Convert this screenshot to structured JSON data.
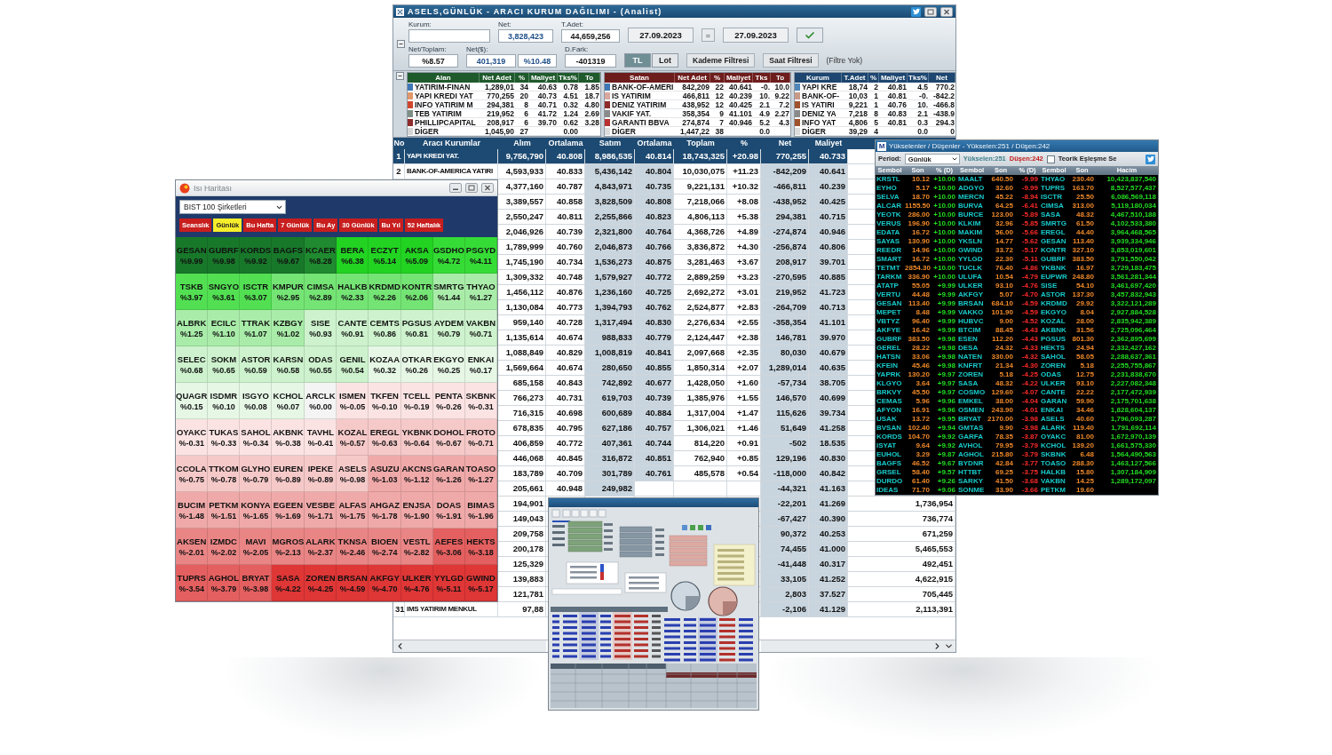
{
  "main_window": {
    "title": "ASELS,GÜNLÜK - ARACI KURUM DAĞILIMI - (Analist)",
    "form": {
      "kurum": {
        "label": "Kurum:"
      },
      "net": {
        "label": "Net:",
        "value": "3,828,423"
      },
      "total_quantity": {
        "label": "T.Adet:",
        "value": "44,659,256"
      },
      "date_from": "27.09.2023",
      "date_separator": "=",
      "date_to": "27.09.2023",
      "net_ratio": {
        "label": "Net/Toplam:",
        "value": "%8.57"
      },
      "net_usd": {
        "label": "Net($):",
        "value": "401,319",
        "percent": "%10.48"
      },
      "difference": {
        "label": "D.Fark:",
        "value": "-401319"
      },
      "unit_toggle": [
        {
          "label": "TL",
          "selected": true
        },
        {
          "label": "Lot",
          "selected": false
        }
      ],
      "filter_buttons": [
        "Kademe Filtresi",
        "Saat Filtresi"
      ],
      "filter_status": "(Filtre Yok)"
    },
    "summary_tables": [
      {
        "kind": "buyers",
        "title": "Alan",
        "columns": [
          "Net Adet",
          "%",
          "Maliyet",
          "Tks%",
          "To"
        ],
        "rows": [
          {
            "color": "#3f78b5",
            "name": "YATIRIM-FINAN",
            "cells": [
              "1,289,01",
              "34",
              "40.63",
              "0.78",
              "1.85"
            ]
          },
          {
            "color": "#e0986a",
            "name": "YAPI KREDI YAT",
            "cells": [
              "770,255",
              "20",
              "40.73",
              "4.51",
              "18.7"
            ]
          },
          {
            "color": "#d0452e",
            "name": "INFO YATIRIM M",
            "cells": [
              "294,381",
              "8",
              "40.71",
              "0.32",
              "4.80"
            ]
          },
          {
            "color": "#7e8f86",
            "name": "TEB YATIRIM",
            "cells": [
              "219,952",
              "6",
              "41.72",
              "1.24",
              "2.69"
            ]
          },
          {
            "color": "#8e2a2a",
            "name": "PHILLIPCAPITAL",
            "cells": [
              "208,917",
              "6",
              "39.70",
              "0.62",
              "3.28"
            ]
          },
          {
            "color": "#d4d4d4",
            "name": "DİGER",
            "cells": [
              "1,045,90",
              "27",
              null,
              "0.00",
              null
            ]
          }
        ]
      },
      {
        "kind": "sellers",
        "title": "Satan",
        "columns": [
          "Net Adet",
          "%",
          "Maliyet",
          "Tks",
          "To"
        ],
        "rows": [
          {
            "color": "#3f78b5",
            "name": "BANK-OF-AMERI",
            "cells": [
              "842,209",
              "22",
              "40.641",
              "-0.",
              "10.0"
            ]
          },
          {
            "color": "#d8a8a0",
            "name": "IS YATIRIM",
            "cells": [
              "466,811",
              "12",
              "40.239",
              "10.",
              "9.22"
            ]
          },
          {
            "color": "#8e2a2a",
            "name": "DENIZ YATIRIM",
            "cells": [
              "438,952",
              "12",
              "40.425",
              "2.1",
              "7.2"
            ]
          },
          {
            "color": "#8a8a8a",
            "name": "VAKIF YAT.",
            "cells": [
              "358,354",
              "9",
              "41.101",
              "4.9",
              "2.27"
            ]
          },
          {
            "color": "#b83030",
            "name": "GARANTI BBVA",
            "cells": [
              "274,874",
              "7",
              "40.946",
              "5.2",
              "4.3"
            ]
          },
          {
            "color": "#dcdcdc",
            "name": "DİGER",
            "cells": [
              "1,447,22",
              "38",
              null,
              "0.0",
              null
            ]
          }
        ]
      },
      {
        "kind": "brokers",
        "title": "Kurum",
        "columns": [
          "T.Adet",
          "%",
          "Maliyet",
          "Tks%",
          "Net"
        ],
        "rows": [
          {
            "color": "#4f86b8",
            "name": "YAPI KRE",
            "cells": [
              "18,74",
              "2",
              "40.81",
              "4.5",
              "770.2"
            ]
          },
          {
            "color": "#c89a88",
            "name": "BANK-OF-",
            "cells": [
              "10,03",
              "1",
              "40.81",
              "-0.",
              "-842.2"
            ]
          },
          {
            "color": "#a0522d",
            "name": "IS YATIRI",
            "cells": [
              "9,221",
              "1",
              "40.76",
              "10.",
              "-466.8"
            ]
          },
          {
            "color": "#8a8a8a",
            "name": "DENIZ YA",
            "cells": [
              "7,218",
              "8",
              "40.83",
              "2.1",
              "-438.9"
            ]
          },
          {
            "color": "#a0522d",
            "name": "INFO YAT",
            "cells": [
              "4,806",
              "5",
              "40.81",
              "0.3",
              "294.3"
            ]
          },
          {
            "color": "#dcdcdc",
            "name": "DİGER",
            "cells": [
              "39,29",
              "4",
              null,
              "0.0",
              "0"
            ]
          }
        ]
      }
    ],
    "broker_table": {
      "columns": [
        "No",
        "Aracı Kurumlar",
        "Alım",
        "Ortalama",
        "Satım",
        "Ortalama",
        "Toplam",
        "%",
        "Net",
        "Maliyet"
      ],
      "rows": [
        {
          "selected": true,
          "cells": [
            "1",
            "YAPI KREDI YAT.",
            "9,756,790",
            "40.808",
            "8,986,535",
            "40.814",
            "18,743,325",
            "+20.98",
            "770,255",
            "40.733",
            null
          ]
        },
        {
          "selected": false,
          "cells": [
            "2",
            "BANK-OF-AMERICA YATIRI",
            "4,593,933",
            "40.833",
            "5,436,142",
            "40.804",
            "10,030,075",
            "+11.23",
            "-842,209",
            "40.641",
            null
          ]
        },
        {
          "selected": false,
          "cells": [
            null,
            null,
            "4,377,160",
            "40.787",
            "4,843,971",
            "40.735",
            "9,221,131",
            "+10.32",
            "-466,811",
            "40.239",
            null
          ]
        },
        {
          "selected": false,
          "cells": [
            null,
            null,
            "3,389,557",
            "40.858",
            "3,828,509",
            "40.808",
            "7,218,066",
            "+8.08",
            "-438,952",
            "40.425",
            null
          ]
        },
        {
          "selected": false,
          "cells": [
            null,
            null,
            "2,550,247",
            "40.811",
            "2,255,866",
            "40.823",
            "4,806,113",
            "+5.38",
            "294,381",
            "40.715",
            null
          ]
        },
        {
          "selected": false,
          "cells": [
            null,
            null,
            "2,046,926",
            "40.739",
            "2,321,800",
            "40.764",
            "4,368,726",
            "+4.89",
            "-274,874",
            "40.946",
            null
          ]
        },
        {
          "selected": false,
          "cells": [
            null,
            null,
            "1,789,999",
            "40.760",
            "2,046,873",
            "40.766",
            "3,836,872",
            "+4.30",
            "-256,874",
            "40.806",
            null
          ]
        },
        {
          "selected": false,
          "cells": [
            null,
            null,
            "1,745,190",
            "40.734",
            "1,536,273",
            "40.875",
            "3,281,463",
            "+3.67",
            "208,917",
            "39.701",
            null
          ]
        },
        {
          "selected": false,
          "cells": [
            null,
            null,
            "1,309,332",
            "40.748",
            "1,579,927",
            "40.772",
            "2,889,259",
            "+3.23",
            "-270,595",
            "40.885",
            null
          ]
        },
        {
          "selected": false,
          "cells": [
            null,
            null,
            "1,456,112",
            "40.876",
            "1,236,160",
            "40.725",
            "2,692,272",
            "+3.01",
            "219,952",
            "41.723",
            null
          ]
        },
        {
          "selected": false,
          "cells": [
            null,
            null,
            "1,130,084",
            "40.773",
            "1,394,793",
            "40.762",
            "2,524,877",
            "+2.83",
            "-264,709",
            "40.713",
            null
          ]
        },
        {
          "selected": false,
          "cells": [
            null,
            null,
            "959,140",
            "40.728",
            "1,317,494",
            "40.830",
            "2,276,634",
            "+2.55",
            "-358,354",
            "41.101",
            null
          ]
        },
        {
          "selected": false,
          "cells": [
            null,
            null,
            "1,135,614",
            "40.674",
            "988,833",
            "40.779",
            "2,124,447",
            "+2.38",
            "146,781",
            "39.970",
            null
          ]
        },
        {
          "selected": false,
          "cells": [
            null,
            null,
            "1,088,849",
            "40.829",
            "1,008,819",
            "40.841",
            "2,097,668",
            "+2.35",
            "80,030",
            "40.679",
            null
          ]
        },
        {
          "selected": false,
          "cells": [
            null,
            null,
            "1,569,664",
            "40.674",
            "280,650",
            "40.855",
            "1,850,314",
            "+2.07",
            "1,289,014",
            "40.635",
            null
          ]
        },
        {
          "selected": false,
          "cells": [
            null,
            null,
            "685,158",
            "40.843",
            "742,892",
            "40.677",
            "1,428,050",
            "+1.60",
            "-57,734",
            "38.705",
            null
          ]
        },
        {
          "selected": false,
          "cells": [
            null,
            null,
            "766,273",
            "40.731",
            "619,703",
            "40.739",
            "1,385,976",
            "+1.55",
            "146,570",
            "40.699",
            null
          ]
        },
        {
          "selected": false,
          "cells": [
            null,
            null,
            "716,315",
            "40.698",
            "600,689",
            "40.884",
            "1,317,004",
            "+1.47",
            "115,626",
            "39.734",
            null
          ]
        },
        {
          "selected": false,
          "cells": [
            null,
            null,
            "678,835",
            "40.795",
            "627,186",
            "40.757",
            "1,306,021",
            "+1.46",
            "51,649",
            "41.258",
            null
          ]
        },
        {
          "selected": false,
          "cells": [
            null,
            null,
            "406,859",
            "40.772",
            "407,361",
            "40.744",
            "814,220",
            "+0.91",
            "-502",
            "18.535",
            null
          ]
        },
        {
          "selected": false,
          "cells": [
            null,
            null,
            "446,068",
            "40.845",
            "316,872",
            "40.851",
            "762,940",
            "+0.85",
            "129,196",
            "40.830",
            null
          ]
        },
        {
          "selected": false,
          "cells": [
            null,
            null,
            "183,789",
            "40.709",
            "301,789",
            "40.761",
            "485,578",
            "+0.54",
            "-118,000",
            "40.842",
            null
          ]
        },
        {
          "selected": false,
          "cells": [
            null,
            null,
            "205,661",
            "40.948",
            "249,982",
            null,
            null,
            null,
            "-44,321",
            "41.163",
            null
          ]
        },
        {
          "selected": false,
          "cells": [
            null,
            null,
            "194,901",
            null,
            null,
            null,
            null,
            null,
            "-22,201",
            "41.269",
            "1,736,954"
          ]
        },
        {
          "selected": false,
          "cells": [
            null,
            null,
            "149,043",
            null,
            null,
            null,
            null,
            null,
            "-67,427",
            "40.390",
            "736,774"
          ]
        },
        {
          "selected": false,
          "cells": [
            null,
            null,
            "209,758",
            null,
            null,
            null,
            null,
            null,
            "90,372",
            "40.253",
            "671,259"
          ]
        },
        {
          "selected": false,
          "cells": [
            null,
            null,
            "200,178",
            null,
            null,
            null,
            null,
            null,
            "74,455",
            "41.000",
            "5,465,553"
          ]
        },
        {
          "selected": false,
          "cells": [
            null,
            null,
            "125,329",
            null,
            null,
            null,
            null,
            null,
            "-41,448",
            "40.317",
            "492,451"
          ]
        },
        {
          "selected": false,
          "cells": [
            null,
            null,
            "139,883",
            null,
            null,
            null,
            null,
            null,
            "33,105",
            "41.252",
            "4,622,915"
          ]
        },
        {
          "selected": false,
          "cells": [
            null,
            null,
            "121,781",
            null,
            null,
            null,
            null,
            null,
            "2,803",
            "37.527",
            "705,445"
          ]
        },
        {
          "selected": false,
          "cells": [
            "31",
            "IMS YATIRIM MENKUL",
            "97,88",
            null,
            null,
            null,
            null,
            null,
            "-2,106",
            "41.129",
            "2,113,391"
          ]
        }
      ]
    }
  },
  "heatmap_window": {
    "title": "Isı Haritası",
    "index_selector": "BIST 100 Şirketleri",
    "tabs": [
      {
        "label": "Seanslık",
        "selected": false
      },
      {
        "label": "Günlük",
        "selected": true
      },
      {
        "label": "Bu Hafta",
        "selected": false
      },
      {
        "label": "7 Günlük",
        "selected": false
      },
      {
        "label": "Bu Ay",
        "selected": false
      },
      {
        "label": "30 Günlük",
        "selected": false
      },
      {
        "label": "Bu Yıl",
        "selected": false
      },
      {
        "label": "52 Haftalık",
        "selected": false
      }
    ],
    "cells": [
      {
        "symbol": "GESAN",
        "change": "%9.99",
        "color": "#18782a"
      },
      {
        "symbol": "GUBRF",
        "change": "%9.98",
        "color": "#18782a"
      },
      {
        "symbol": "KORDS",
        "change": "%9.92",
        "color": "#18782a"
      },
      {
        "symbol": "BAGFS",
        "change": "%9.67",
        "color": "#18782a"
      },
      {
        "symbol": "KCAER",
        "change": "%8.28",
        "color": "#1f8a2f"
      },
      {
        "symbol": "BERA",
        "change": "%6.38",
        "color": "#22d322"
      },
      {
        "symbol": "ECZYT",
        "change": "%5.14",
        "color": "#22d322"
      },
      {
        "symbol": "AKSA",
        "change": "%5.09",
        "color": "#22d322"
      },
      {
        "symbol": "GSDHO",
        "change": "%4.72",
        "color": "#36dc36"
      },
      {
        "symbol": "PSGYD",
        "change": "%4.11",
        "color": "#36dc36"
      },
      {
        "symbol": "TSKB",
        "change": "%3.97",
        "color": "#52e052"
      },
      {
        "symbol": "SNGYO",
        "change": "%3.61",
        "color": "#52e052"
      },
      {
        "symbol": "ISCTR",
        "change": "%3.07",
        "color": "#52e052"
      },
      {
        "symbol": "KMPUR",
        "change": "%2.95",
        "color": "#74e474"
      },
      {
        "symbol": "CIMSA",
        "change": "%2.89",
        "color": "#74e474"
      },
      {
        "symbol": "HALKB",
        "change": "%2.33",
        "color": "#74e474"
      },
      {
        "symbol": "KRDMD",
        "change": "%2.26",
        "color": "#74e474"
      },
      {
        "symbol": "KONTR",
        "change": "%2.06",
        "color": "#74e474"
      },
      {
        "symbol": "SMRTG",
        "change": "%1.44",
        "color": "#a9eca9"
      },
      {
        "symbol": "THYAO",
        "change": "%1.27",
        "color": "#a9eca9"
      },
      {
        "symbol": "ALBRK",
        "change": "%1.25",
        "color": "#a9eca9"
      },
      {
        "symbol": "ECILC",
        "change": "%1.10",
        "color": "#a9eca9"
      },
      {
        "symbol": "TTRAK",
        "change": "%1.07",
        "color": "#a9eca9"
      },
      {
        "symbol": "KZBGY",
        "change": "%1.02",
        "color": "#a9eca9"
      },
      {
        "symbol": "SISE",
        "change": "%0.93",
        "color": "#cdf2cd"
      },
      {
        "symbol": "CANTE",
        "change": "%0.91",
        "color": "#cdf2cd"
      },
      {
        "symbol": "CEMTS",
        "change": "%0.86",
        "color": "#cdf2cd"
      },
      {
        "symbol": "PGSUS",
        "change": "%0.81",
        "color": "#cdf2cd"
      },
      {
        "symbol": "AYDEM",
        "change": "%0.79",
        "color": "#cdf2cd"
      },
      {
        "symbol": "VAKBN",
        "change": "%0.71",
        "color": "#cdf2cd"
      },
      {
        "symbol": "SELEC",
        "change": "%0.68",
        "color": "#cdf2cd"
      },
      {
        "symbol": "SOKM",
        "change": "%0.65",
        "color": "#cdf2cd"
      },
      {
        "symbol": "ASTOR",
        "change": "%0.59",
        "color": "#cdf2cd"
      },
      {
        "symbol": "KARSN",
        "change": "%0.58",
        "color": "#cdf2cd"
      },
      {
        "symbol": "ODAS",
        "change": "%0.55",
        "color": "#cdf2cd"
      },
      {
        "symbol": "GENIL",
        "change": "%0.54",
        "color": "#cdf2cd"
      },
      {
        "symbol": "KOZAA",
        "change": "%0.32",
        "color": "#e6f7e6"
      },
      {
        "symbol": "OTKAR",
        "change": "%0.26",
        "color": "#e6f7e6"
      },
      {
        "symbol": "EKGYO",
        "change": "%0.25",
        "color": "#e6f7e6"
      },
      {
        "symbol": "ENKAI",
        "change": "%0.17",
        "color": "#e6f7e6"
      },
      {
        "symbol": "QUAGR",
        "change": "%0.15",
        "color": "#e6f7e6"
      },
      {
        "symbol": "ISDMR",
        "change": "%0.10",
        "color": "#e6f7e6"
      },
      {
        "symbol": "ISGYO",
        "change": "%0.08",
        "color": "#e6f7e6"
      },
      {
        "symbol": "KCHOL",
        "change": "%0.07",
        "color": "#e6f7e6"
      },
      {
        "symbol": "ARCLK",
        "change": "%0.00",
        "color": "#f4f4f4"
      },
      {
        "symbol": "ISMEN",
        "change": "%-0.05",
        "color": "#fbe3e3"
      },
      {
        "symbol": "TKFEN",
        "change": "%-0.10",
        "color": "#fbe3e3"
      },
      {
        "symbol": "TCELL",
        "change": "%-0.19",
        "color": "#fbe3e3"
      },
      {
        "symbol": "PENTA",
        "change": "%-0.26",
        "color": "#fbe3e3"
      },
      {
        "symbol": "SKBNK",
        "change": "%-0.31",
        "color": "#fbe3e3"
      },
      {
        "symbol": "OYAKC",
        "change": "%-0.31",
        "color": "#fbe3e3"
      },
      {
        "symbol": "TUKAS",
        "change": "%-0.33",
        "color": "#fbe3e3"
      },
      {
        "symbol": "SAHOL",
        "change": "%-0.34",
        "color": "#fbe3e3"
      },
      {
        "symbol": "AKBNK",
        "change": "%-0.38",
        "color": "#fbe3e3"
      },
      {
        "symbol": "TAVHL",
        "change": "%-0.41",
        "color": "#fbe3e3"
      },
      {
        "symbol": "KOZAL",
        "change": "%-0.57",
        "color": "#f6c9c9"
      },
      {
        "symbol": "EREGL",
        "change": "%-0.63",
        "color": "#f6c9c9"
      },
      {
        "symbol": "YKBNK",
        "change": "%-0.64",
        "color": "#f6c9c9"
      },
      {
        "symbol": "DOHOL",
        "change": "%-0.67",
        "color": "#f6c9c9"
      },
      {
        "symbol": "FROTO",
        "change": "%-0.71",
        "color": "#f6c9c9"
      },
      {
        "symbol": "CCOLA",
        "change": "%-0.75",
        "color": "#f6c9c9"
      },
      {
        "symbol": "TTKOM",
        "change": "%-0.78",
        "color": "#f6c9c9"
      },
      {
        "symbol": "GLYHO",
        "change": "%-0.79",
        "color": "#f6c9c9"
      },
      {
        "symbol": "EUREN",
        "change": "%-0.89",
        "color": "#f6c9c9"
      },
      {
        "symbol": "IPEKE",
        "change": "%-0.89",
        "color": "#f6c9c9"
      },
      {
        "symbol": "ASELS",
        "change": "%-0.98",
        "color": "#f6c9c9"
      },
      {
        "symbol": "ASUZU",
        "change": "%-1.03",
        "color": "#f0a9a9"
      },
      {
        "symbol": "AKCNS",
        "change": "%-1.12",
        "color": "#f0a9a9"
      },
      {
        "symbol": "GARAN",
        "change": "%-1.26",
        "color": "#f0a9a9"
      },
      {
        "symbol": "TOASO",
        "change": "%-1.27",
        "color": "#f0a9a9"
      },
      {
        "symbol": "BUCIM",
        "change": "%-1.48",
        "color": "#f0a9a9"
      },
      {
        "symbol": "PETKM",
        "change": "%-1.51",
        "color": "#f0a9a9"
      },
      {
        "symbol": "KONYA",
        "change": "%-1.65",
        "color": "#f0a9a9"
      },
      {
        "symbol": "EGEEN",
        "change": "%-1.69",
        "color": "#f0a9a9"
      },
      {
        "symbol": "VESBE",
        "change": "%-1.71",
        "color": "#f0a9a9"
      },
      {
        "symbol": "ALFAS",
        "change": "%-1.75",
        "color": "#f0a9a9"
      },
      {
        "symbol": "AHGAZ",
        "change": "%-1.78",
        "color": "#f0a9a9"
      },
      {
        "symbol": "ENJSA",
        "change": "%-1.90",
        "color": "#f0a9a9"
      },
      {
        "symbol": "DOAS",
        "change": "%-1.91",
        "color": "#f0a9a9"
      },
      {
        "symbol": "BIMAS",
        "change": "%-1.96",
        "color": "#f0a9a9"
      },
      {
        "symbol": "AKSEN",
        "change": "%-2.01",
        "color": "#ea8585"
      },
      {
        "symbol": "IZMDC",
        "change": "%-2.02",
        "color": "#ea8585"
      },
      {
        "symbol": "MAVI",
        "change": "%-2.05",
        "color": "#ea8585"
      },
      {
        "symbol": "MGROS",
        "change": "%-2.13",
        "color": "#ea8585"
      },
      {
        "symbol": "ALARK",
        "change": "%-2.37",
        "color": "#ea8585"
      },
      {
        "symbol": "TKNSA",
        "change": "%-2.46",
        "color": "#ea8585"
      },
      {
        "symbol": "BIOEN",
        "change": "%-2.74",
        "color": "#ea8585"
      },
      {
        "symbol": "VESTL",
        "change": "%-2.82",
        "color": "#ea8585"
      },
      {
        "symbol": "AEFES",
        "change": "%-3.06",
        "color": "#e45f5f"
      },
      {
        "symbol": "HEKTS",
        "change": "%-3.18",
        "color": "#e45f5f"
      },
      {
        "symbol": "TUPRS",
        "change": "%-3.54",
        "color": "#e45f5f"
      },
      {
        "symbol": "AGHOL",
        "change": "%-3.79",
        "color": "#e45f5f"
      },
      {
        "symbol": "BRYAT",
        "change": "%-3.98",
        "color": "#e45f5f"
      },
      {
        "symbol": "SASA",
        "change": "%-4.22",
        "color": "#df3636"
      },
      {
        "symbol": "ZOREN",
        "change": "%-4.25",
        "color": "#df3636"
      },
      {
        "symbol": "BRSAN",
        "change": "%-4.59",
        "color": "#df3636"
      },
      {
        "symbol": "AKFGY",
        "change": "%-4.70",
        "color": "#df3636"
      },
      {
        "symbol": "ULKER",
        "change": "%-4.76",
        "color": "#df3636"
      },
      {
        "symbol": "YYLGD",
        "change": "%-5.11",
        "color": "#df3636"
      },
      {
        "symbol": "GWIND",
        "change": "%-5.17",
        "color": "#df3636"
      }
    ]
  },
  "movers_window": {
    "logo": "M",
    "title": "Yükselenler / Düşenler - Yükselen:251 / Düşen:242",
    "period": {
      "label": "Period:",
      "value": "Günlük"
    },
    "rising_count": "Yükselen:251",
    "falling_count": "Düşen:242",
    "theoretical_match": {
      "label": "Teorik Eşleşme Se",
      "checked": false
    },
    "lists": [
      {
        "kind": "gainers",
        "headers": [
          "Sembol",
          "Son",
          "% (D)"
        ],
        "rows": [
          [
            "KRSTL",
            "10.12",
            "+10.00"
          ],
          [
            "EYHO",
            "5.17",
            "+10.00"
          ],
          [
            "SELVA",
            "18.70",
            "+10.00"
          ],
          [
            "ALCAR",
            "1155.50",
            "+10.00"
          ],
          [
            "YEOTK",
            "286.00",
            "+10.00"
          ],
          [
            "VERUS",
            "196.90",
            "+10.00"
          ],
          [
            "EDATA",
            "16.72",
            "+10.00"
          ],
          [
            "SAYAS",
            "130.90",
            "+10.00"
          ],
          [
            "REEDR",
            "14.96",
            "+10.00"
          ],
          [
            "SMART",
            "16.72",
            "+10.00"
          ],
          [
            "TETMT",
            "2854.30",
            "+10.00"
          ],
          [
            "TARKM",
            "336.90",
            "+10.00"
          ],
          [
            "ATATP",
            "55.05",
            "+9.99"
          ],
          [
            "VERTU",
            "44.48",
            "+9.99"
          ],
          [
            "GESAN",
            "113.40",
            "+9.99"
          ],
          [
            "MEPET",
            "8.48",
            "+9.99"
          ],
          [
            "VBTYZ",
            "96.40",
            "+9.99"
          ],
          [
            "AKFYE",
            "16.42",
            "+9.99"
          ],
          [
            "GUBRF",
            "383.50",
            "+9.98"
          ],
          [
            "GEREL",
            "28.22",
            "+9.98"
          ],
          [
            "HATSN",
            "33.06",
            "+9.98"
          ],
          [
            "KFEIN",
            "45.46",
            "+9.98"
          ],
          [
            "YAPRK",
            "130.20",
            "+9.97"
          ],
          [
            "KLGYO",
            "3.64",
            "+9.97"
          ],
          [
            "BRKVY",
            "45.50",
            "+9.97"
          ],
          [
            "CEMAS",
            "5.96",
            "+9.96"
          ],
          [
            "AFYON",
            "16.91",
            "+9.96"
          ],
          [
            "USAK",
            "13.72",
            "+9.95"
          ],
          [
            "BVSAN",
            "102.40",
            "+9.94"
          ],
          [
            "KORDS",
            "104.70",
            "+9.92"
          ],
          [
            "ISYAT",
            "9.64",
            "+9.92"
          ],
          [
            "EUHOL",
            "3.29",
            "+9.87"
          ],
          [
            "BAGFS",
            "46.52",
            "+9.67"
          ],
          [
            "GRSEL",
            "58.40",
            "+9.57"
          ],
          [
            "DURDO",
            "61.40",
            "+9.26"
          ],
          [
            "IDEAS",
            "71.70",
            "+9.06"
          ]
        ]
      },
      {
        "kind": "losers",
        "headers": [
          "Sembol",
          "Son",
          "% (D)"
        ],
        "rows": [
          [
            "MAALT",
            "640.50",
            "-9.99"
          ],
          [
            "ADGYO",
            "32.60",
            "-9.99"
          ],
          [
            "MERCN",
            "45.22",
            "-8.94"
          ],
          [
            "BURVA",
            "64.25",
            "-6.41"
          ],
          [
            "BURCE",
            "123.00",
            "-5.89"
          ],
          [
            "KLKIM",
            "32.96",
            "-5.85"
          ],
          [
            "MAKIM",
            "56.00",
            "-5.66"
          ],
          [
            "YKSLN",
            "14.77",
            "-5.62"
          ],
          [
            "GWIND",
            "33.72",
            "-5.17"
          ],
          [
            "YYLGD",
            "22.30",
            "-5.11"
          ],
          [
            "TUCLK",
            "76.40",
            "-4.86"
          ],
          [
            "ULUFA",
            "10.54",
            "-4.79"
          ],
          [
            "ULKER",
            "93.10",
            "-4.76"
          ],
          [
            "AKFGY",
            "5.07",
            "-4.70"
          ],
          [
            "BRSAN",
            "684.10",
            "-4.59"
          ],
          [
            "VAKKO",
            "101.90",
            "-4.59"
          ],
          [
            "HUBVC",
            "9.00",
            "-4.52"
          ],
          [
            "BTCIM",
            "88.45",
            "-4.43"
          ],
          [
            "ESEN",
            "112.20",
            "-4.43"
          ],
          [
            "DESA",
            "24.32",
            "-4.33"
          ],
          [
            "NATEN",
            "330.00",
            "-4.32"
          ],
          [
            "KNFRT",
            "21.34",
            "-4.30"
          ],
          [
            "ZOREN",
            "5.18",
            "-4.25"
          ],
          [
            "SASA",
            "48.32",
            "-4.22"
          ],
          [
            "COSMO",
            "129.60",
            "-4.07"
          ],
          [
            "EMKEL",
            "38.00",
            "-4.04"
          ],
          [
            "OSMEN",
            "243.90",
            "-4.01"
          ],
          [
            "BRYAT",
            "2170.00",
            "-3.98"
          ],
          [
            "GMTAS",
            "9.90",
            "-3.98"
          ],
          [
            "GARFA",
            "78.35",
            "-3.87"
          ],
          [
            "AVHOL",
            "79.95",
            "-3.79"
          ],
          [
            "AGHOL",
            "215.80",
            "-3.79"
          ],
          [
            "BYDNR",
            "42.84",
            "-3.77"
          ],
          [
            "HTTBT",
            "69.25",
            "-3.75"
          ],
          [
            "SARKY",
            "41.50",
            "-3.68"
          ],
          [
            "SONME",
            "33.90",
            "-3.66"
          ]
        ]
      },
      {
        "kind": "volume",
        "headers": [
          "Sembol",
          "Son",
          "Hacim"
        ],
        "rows": [
          [
            "THYAO",
            "230.40",
            "10,423,837,540"
          ],
          [
            "TUPRS",
            "163.70",
            "8,527,577,437"
          ],
          [
            "ISCTR",
            "25.50",
            "6,086,569,118"
          ],
          [
            "CIMSA",
            "313.00",
            "5,119,180,034"
          ],
          [
            "SASA",
            "48.32",
            "4,467,510,188"
          ],
          [
            "SMRTG",
            "61.50",
            "4,102,533,380"
          ],
          [
            "EREGL",
            "44.40",
            "3,964,468,565"
          ],
          [
            "GESAN",
            "113.40",
            "3,939,334,946"
          ],
          [
            "KONTR",
            "327.10",
            "3,853,019,601"
          ],
          [
            "GUBRF",
            "383.50",
            "3,791,550,042"
          ],
          [
            "YKBNK",
            "16.97",
            "3,729,183,475"
          ],
          [
            "EUPWR",
            "248.80",
            "3,561,281,344"
          ],
          [
            "SISE",
            "54.10",
            "3,461,697,420"
          ],
          [
            "ASTOR",
            "137.30",
            "3,457,832,943"
          ],
          [
            "KRDMD",
            "29.92",
            "3,322,121,289"
          ],
          [
            "EKGYO",
            "8.04",
            "2,927,884,528"
          ],
          [
            "KOZAL",
            "28.00",
            "2,835,942,389"
          ],
          [
            "AKBNK",
            "31.56",
            "2,725,096,464"
          ],
          [
            "PGSUS",
            "801.30",
            "2,362,895,699"
          ],
          [
            "HEKTS",
            "24.94",
            "2,332,427,162"
          ],
          [
            "SAHOL",
            "58.05",
            "2,288,637,361"
          ],
          [
            "ZOREN",
            "5.18",
            "2,255,755,867"
          ],
          [
            "ODAS",
            "12.75",
            "2,231,838,670"
          ],
          [
            "ULKER",
            "93.10",
            "2,227,082,348"
          ],
          [
            "CANTE",
            "22.22",
            "2,177,472,939"
          ],
          [
            "GARAN",
            "59.90",
            "2,175,701,638"
          ],
          [
            "ENKAI",
            "34.46",
            "1,828,604,137"
          ],
          [
            "ASELS",
            "40.60",
            "1,796,093,287"
          ],
          [
            "ALARK",
            "119.40",
            "1,791,692,114"
          ],
          [
            "OYAKC",
            "81.00",
            "1,672,970,139"
          ],
          [
            "KCHOL",
            "139.20",
            "1,661,575,330"
          ],
          [
            "SKBNK",
            "6.48",
            "1,564,490,563"
          ],
          [
            "TOASO",
            "288.30",
            "1,463,127,566"
          ],
          [
            "HALKB",
            "15.80",
            "1,307,184,909"
          ],
          [
            "VAKBN",
            "14.25",
            "1,289,172,097"
          ],
          [
            "PETKM",
            "19.60",
            null
          ]
        ]
      }
    ]
  }
}
